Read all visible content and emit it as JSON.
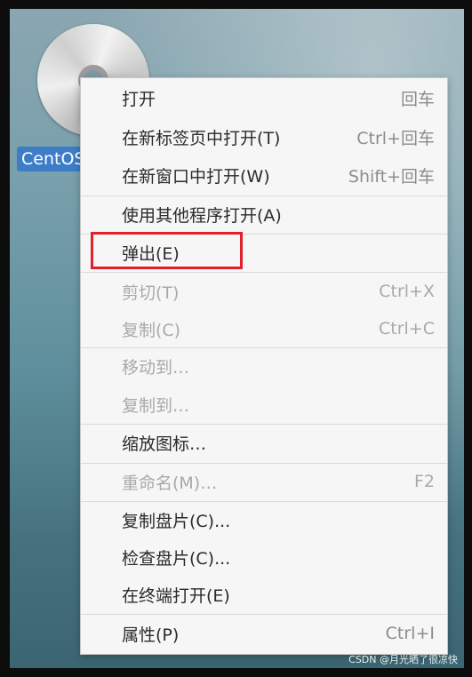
{
  "desktop": {
    "icon_label": "CentOS",
    "watermark": "CSDN @月光晒了很凉快"
  },
  "menu": {
    "items": [
      {
        "label": "打开",
        "accel": "回车",
        "enabled": true
      },
      {
        "label": "在新标签页中打开(T)",
        "accel": "Ctrl+回车",
        "enabled": true
      },
      {
        "label": "在新窗口中打开(W)",
        "accel": "Shift+回车",
        "enabled": true
      },
      {
        "label": "使用其他程序打开(A)",
        "accel": "",
        "enabled": true
      },
      {
        "label": "弹出(E)",
        "accel": "",
        "enabled": true,
        "highlighted": true
      },
      {
        "label": "剪切(T)",
        "accel": "Ctrl+X",
        "enabled": false
      },
      {
        "label": "复制(C)",
        "accel": "Ctrl+C",
        "enabled": false
      },
      {
        "label": "移动到…",
        "accel": "",
        "enabled": false
      },
      {
        "label": "复制到…",
        "accel": "",
        "enabled": false
      },
      {
        "label": "缩放图标…",
        "accel": "",
        "enabled": true
      },
      {
        "label": "重命名(M)…",
        "accel": "F2",
        "enabled": false
      },
      {
        "label": "复制盘片(C)...",
        "accel": "",
        "enabled": true
      },
      {
        "label": "检查盘片(C)...",
        "accel": "",
        "enabled": true
      },
      {
        "label": "在终端打开(E)",
        "accel": "",
        "enabled": true
      },
      {
        "label": "属性(P)",
        "accel": "Ctrl+I",
        "enabled": true
      }
    ]
  },
  "colors": {
    "highlight_border": "#e0202a",
    "icon_label_bg": "#3d7cc7"
  }
}
